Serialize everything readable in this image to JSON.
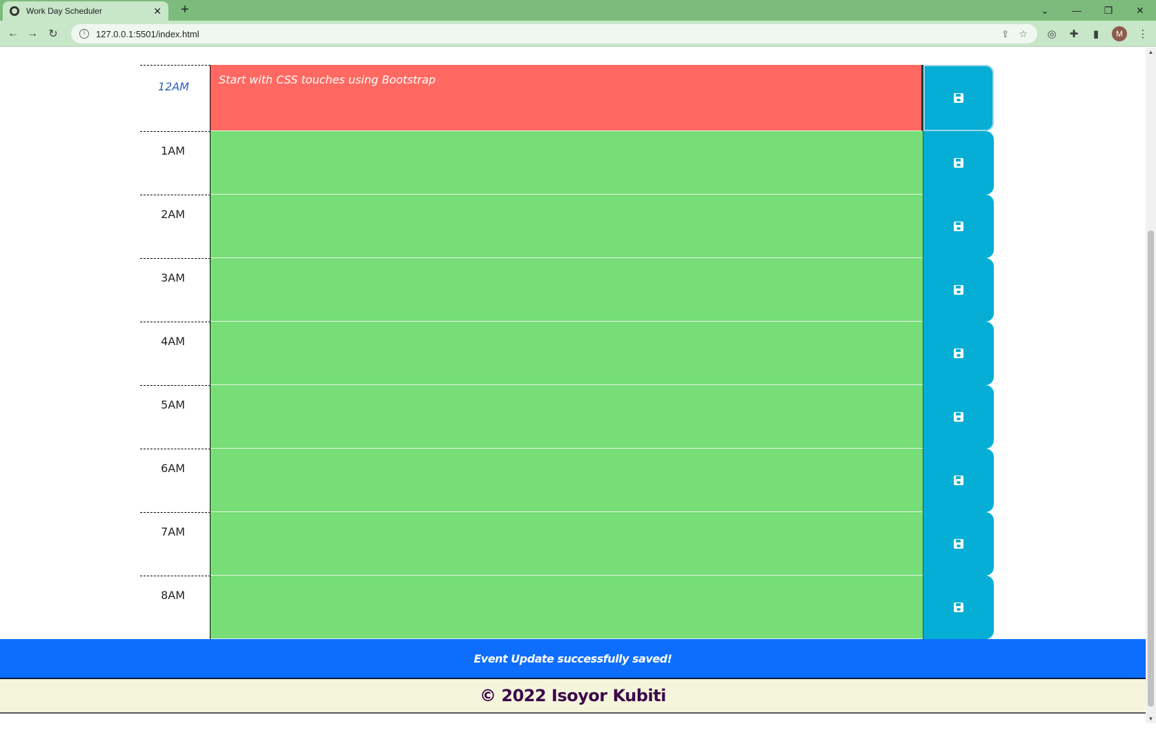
{
  "browser": {
    "tab_title": "Work Day Scheduler",
    "tab_close": "✕",
    "new_tab": "+",
    "url": "127.0.0.1:5501/index.html",
    "avatar_initial": "M"
  },
  "schedule": {
    "rows": [
      {
        "hour": "12AM",
        "status": "present",
        "text": "Start with CSS touches using Bootstrap"
      },
      {
        "hour": "1AM",
        "status": "future",
        "text": ""
      },
      {
        "hour": "2AM",
        "status": "future",
        "text": ""
      },
      {
        "hour": "3AM",
        "status": "future",
        "text": ""
      },
      {
        "hour": "4AM",
        "status": "future",
        "text": ""
      },
      {
        "hour": "5AM",
        "status": "future",
        "text": ""
      },
      {
        "hour": "6AM",
        "status": "future",
        "text": ""
      },
      {
        "hour": "7AM",
        "status": "future",
        "text": ""
      },
      {
        "hour": "8AM",
        "status": "future",
        "text": ""
      }
    ]
  },
  "notice": {
    "message": "Event Update successfully saved!"
  },
  "footer": {
    "copyright": "© 2022 Isoyor Kubiti"
  },
  "colors": {
    "present": "#ff6961",
    "future": "#77dd77",
    "save_button": "#06aed5",
    "notice_bg": "#0d6efd",
    "footer_bg": "#f5f5dc"
  }
}
